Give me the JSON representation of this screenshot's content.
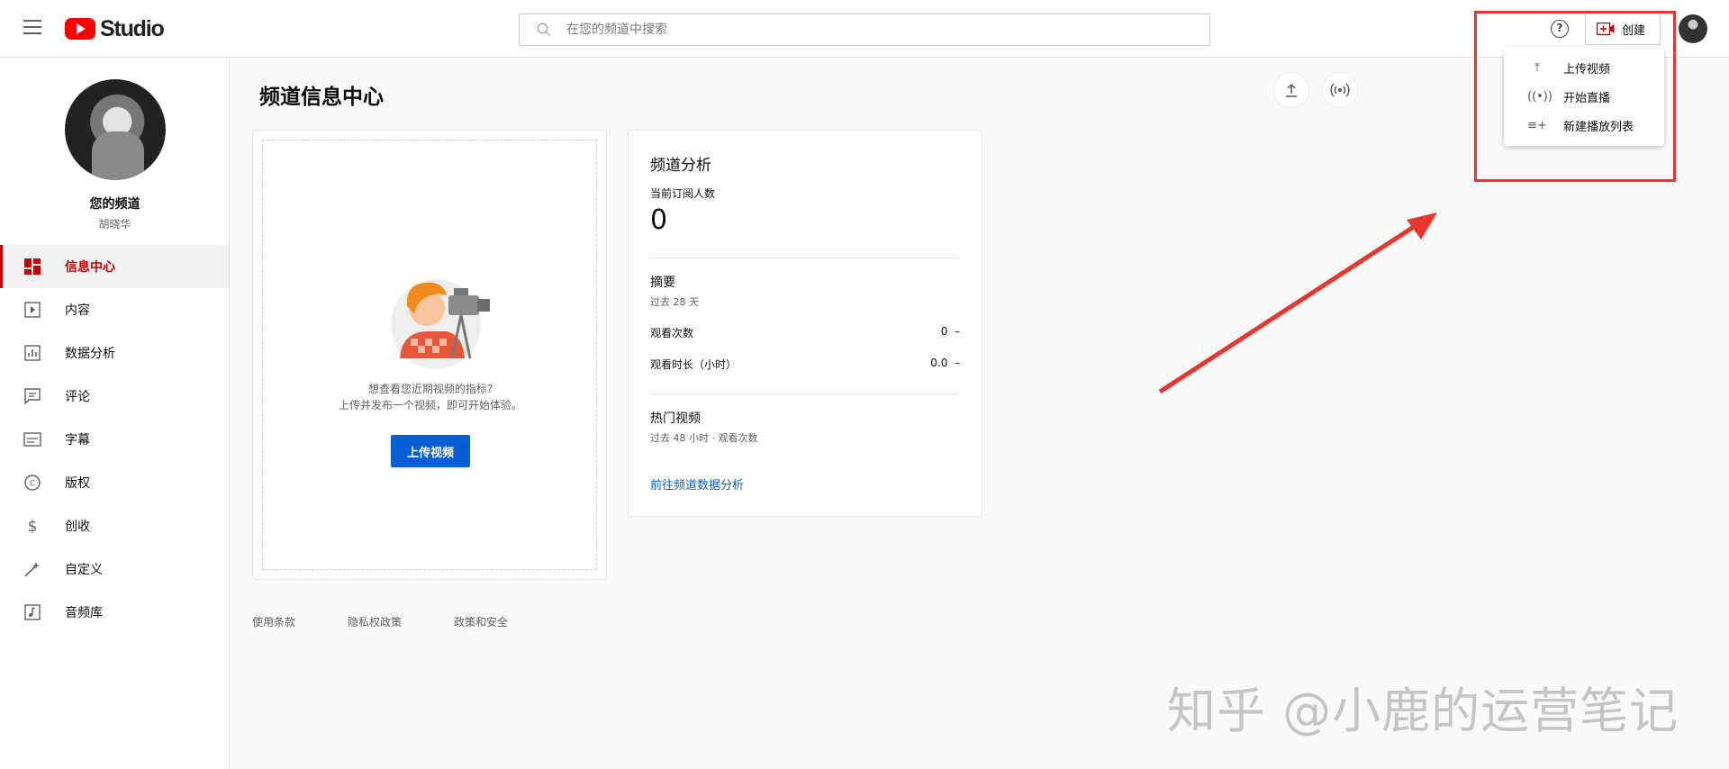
{
  "app": {
    "logo_text": "Studio"
  },
  "search": {
    "placeholder": "在您的频道中搜索"
  },
  "header": {
    "help_glyph": "?",
    "create_label": "创建"
  },
  "channel": {
    "title": "您的频道",
    "owner": "胡晓华"
  },
  "sidebar": {
    "items": [
      {
        "label": "信息中心",
        "icon": "dashboard-icon",
        "active": true
      },
      {
        "label": "内容",
        "icon": "content-icon"
      },
      {
        "label": "数据分析",
        "icon": "analytics-icon"
      },
      {
        "label": "评论",
        "icon": "comments-icon"
      },
      {
        "label": "字幕",
        "icon": "subtitles-icon"
      },
      {
        "label": "版权",
        "icon": "copyright-icon"
      },
      {
        "label": "创收",
        "icon": "monetization-icon"
      },
      {
        "label": "自定义",
        "icon": "customization-icon"
      },
      {
        "label": "音频库",
        "icon": "audio-library-icon"
      }
    ]
  },
  "main": {
    "page_title": "频道信息中心",
    "upload_card": {
      "hint_line1": "想查看您近期视频的指标?",
      "hint_line2": "上传并发布一个视频，即可开始体验。",
      "button_label": "上传视频"
    },
    "analytics_card": {
      "title": "频道分析",
      "subscribers_label": "当前订阅人数",
      "subscribers_value": "0",
      "summary_title": "摘要",
      "summary_period": "过去 28 天",
      "rows": [
        {
          "label": "观看次数",
          "value": "0",
          "trend": "–"
        },
        {
          "label": "观看时长（小时）",
          "value": "0.0",
          "trend": "–"
        }
      ],
      "top_videos_title": "热门视频",
      "top_videos_sub": "过去 48 小时 · 观看次数",
      "link_label": "前往频道数据分析"
    },
    "footer": [
      "使用条款",
      "隐私权政策",
      "政策和安全"
    ]
  },
  "create_menu": {
    "items": [
      {
        "label": "上传视频",
        "icon": "upload-icon"
      },
      {
        "label": "开始直播",
        "icon": "live-icon"
      },
      {
        "label": "新建播放列表",
        "icon": "playlist-add-icon"
      }
    ]
  },
  "watermark": "知乎 @小鹿的运营笔记",
  "colors": {
    "accent": "#cc0000",
    "link": "#065fd4",
    "annotation": "#e8352d"
  }
}
